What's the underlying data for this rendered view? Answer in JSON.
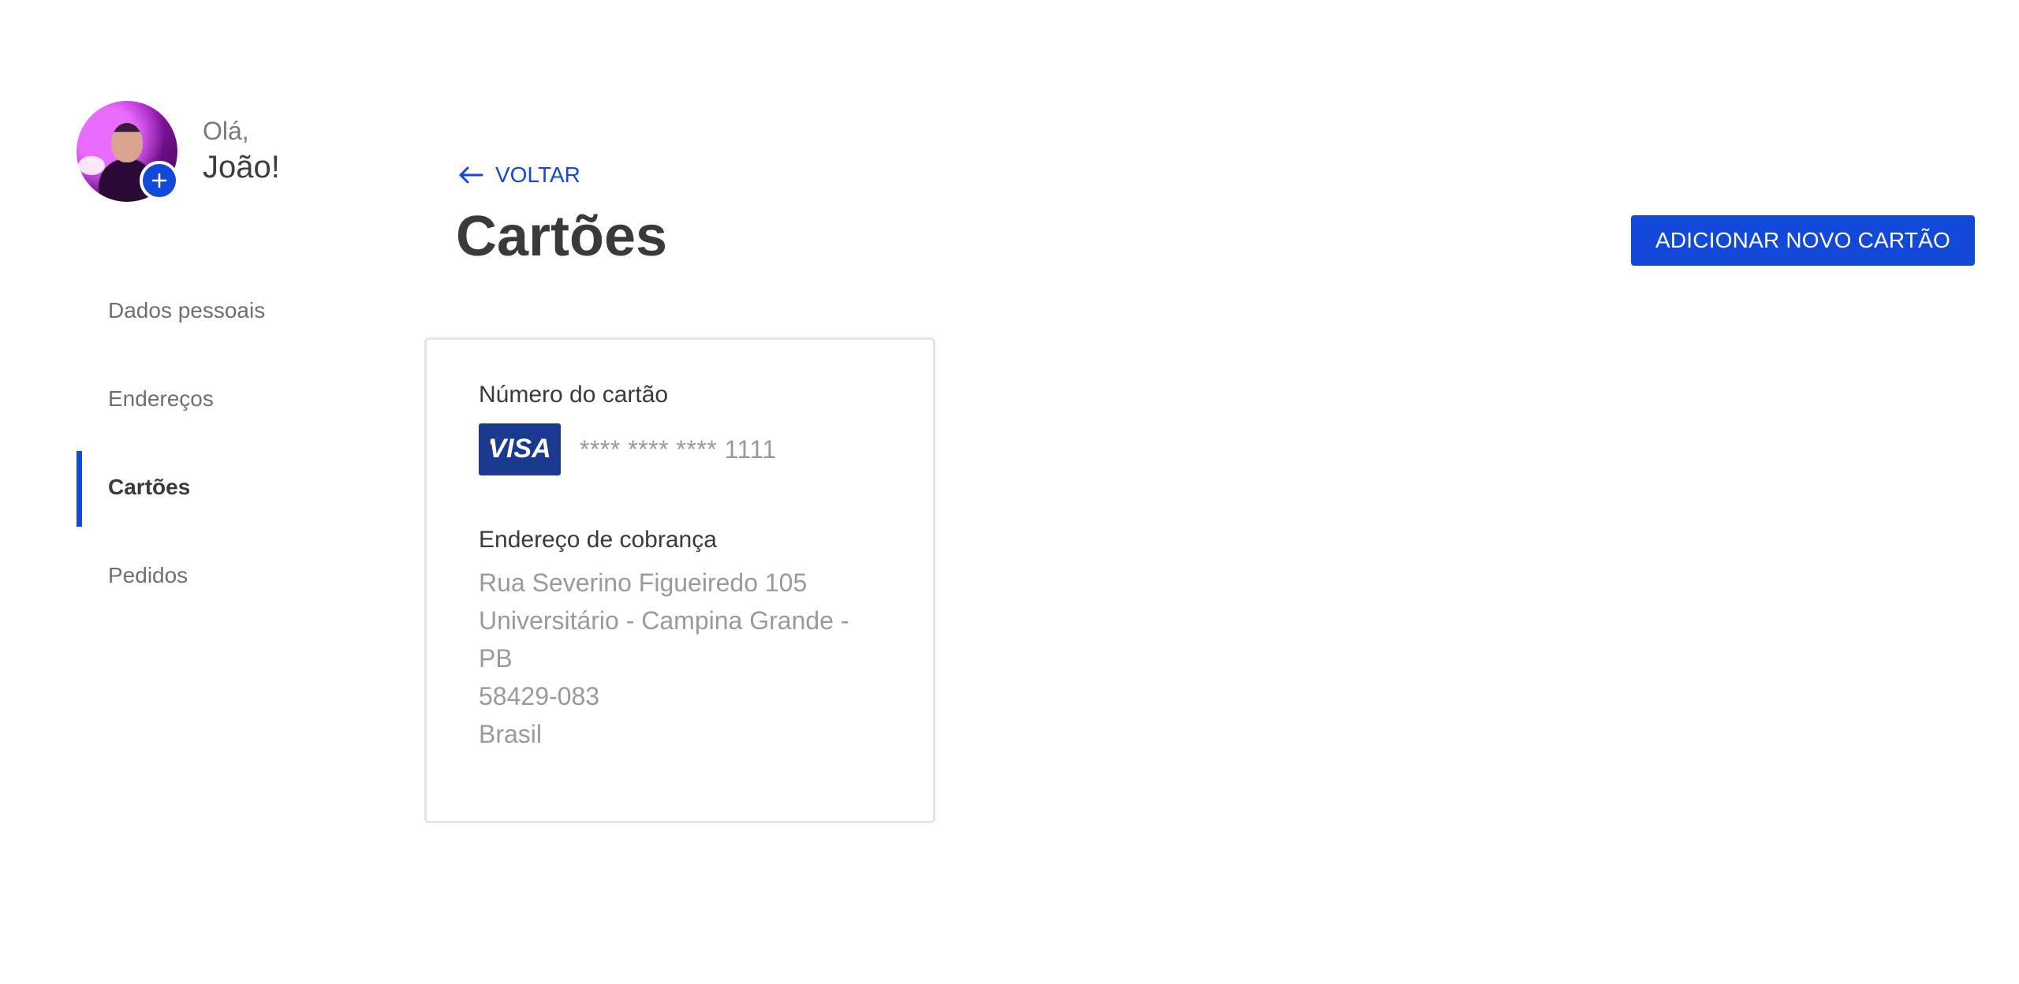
{
  "sidebar": {
    "greeting_hello": "Olá,",
    "greeting_name": "João!",
    "items": [
      {
        "label": "Dados pessoais",
        "active": false
      },
      {
        "label": "Endereços",
        "active": false
      },
      {
        "label": "Cartões",
        "active": true
      },
      {
        "label": "Pedidos",
        "active": false
      }
    ]
  },
  "header": {
    "back_label": "VOLTAR",
    "title": "Cartões",
    "add_button_label": "ADICIONAR NOVO CARTÃO"
  },
  "card": {
    "number_label": "Número do cartão",
    "brand": "VISA",
    "masked_number": "**** **** **** 1111",
    "billing_label": "Endereço de cobrança",
    "address": {
      "street": "Rua Severino Figueiredo 105",
      "district_city_line1": "Universitário - Campina Grande -",
      "state": "PB",
      "postal_code": "58429-083",
      "country": "Brasil"
    }
  },
  "colors": {
    "accent": "#1249d9",
    "text_primary": "#3a3a3a",
    "text_muted": "#9a9a9a",
    "visa_blue": "#1a3a8f"
  },
  "icons": {
    "back": "arrow-left-icon",
    "add_photo": "plus-icon",
    "card_brand": "visa-logo"
  }
}
